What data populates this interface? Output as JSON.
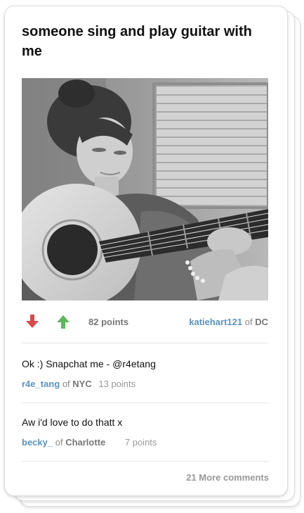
{
  "post": {
    "title": "someone sing and play guitar with me",
    "points": "82 points",
    "author": "katiehart121",
    "of": "of",
    "location": "DC"
  },
  "comments": [
    {
      "text": "Ok :) Snapchat me - @r4etang",
      "user": "r4e_tang",
      "of": "of",
      "location": "NYC",
      "points": "13 points"
    },
    {
      "text": "Aw i'd love to do thatt x",
      "user": "becky_",
      "of": "of",
      "location": "Charlotte",
      "points": "7 points"
    }
  ],
  "more_comments": "21 More comments",
  "icons": {
    "downvote": "arrow-down-icon",
    "upvote": "arrow-up-icon"
  },
  "colors": {
    "downvote": "#d84a4a",
    "upvote": "#5cb85c",
    "link": "#5b93bf"
  }
}
